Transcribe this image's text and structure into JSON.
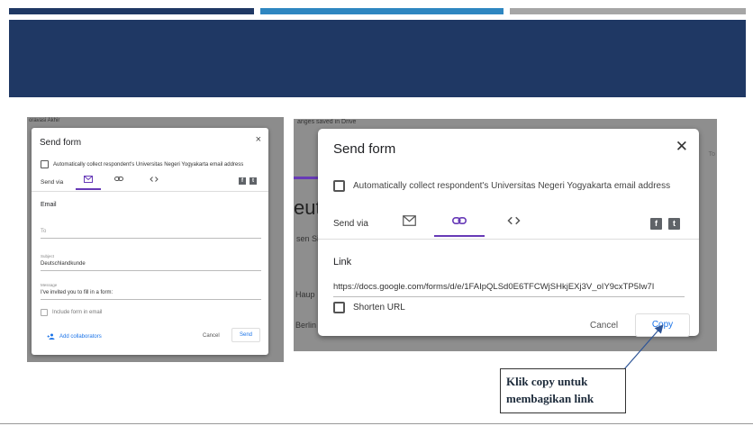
{
  "left": {
    "background_text": "oravasi Akhir",
    "title": "Send form",
    "close": "×",
    "collect_label": "Automatically collect respondent's Universitas Negeri Yogyakarta email address",
    "send_via": "Send via",
    "section": "Email",
    "to_label": "To",
    "subject_label": "Subject",
    "subject_value": "Deutschlandkunde",
    "message_label": "Message",
    "message_value": "I've invited you to fill in a form:",
    "include_label": "Include form in email",
    "add_collaborators": "Add collaborators",
    "cancel": "Cancel",
    "send": "Send"
  },
  "right": {
    "background_top": "anges saved in Drive",
    "background_right": "To",
    "background_word": "eut",
    "background_sub": "sen Si",
    "background_haup": "Haup",
    "background_berlin": "Berlin",
    "title": "Send form",
    "close": "✕",
    "collect_label": "Automatically collect respondent's Universitas Negeri Yogyakarta email address",
    "send_via": "Send via",
    "section": "Link",
    "url": "https://docs.google.com/forms/d/e/1FAIpQLSd0E6TFCWjSHkjEXj3V_oIY9cxTP5Iw7I",
    "shorten": "Shorten URL",
    "cancel": "Cancel",
    "copy": "Copy"
  },
  "callout": {
    "line1": "Klik copy untuk",
    "line2": "membagikan link"
  },
  "colors": {
    "banner": "#1f3864",
    "accent": "#673ab7",
    "link": "#1a73e8"
  }
}
